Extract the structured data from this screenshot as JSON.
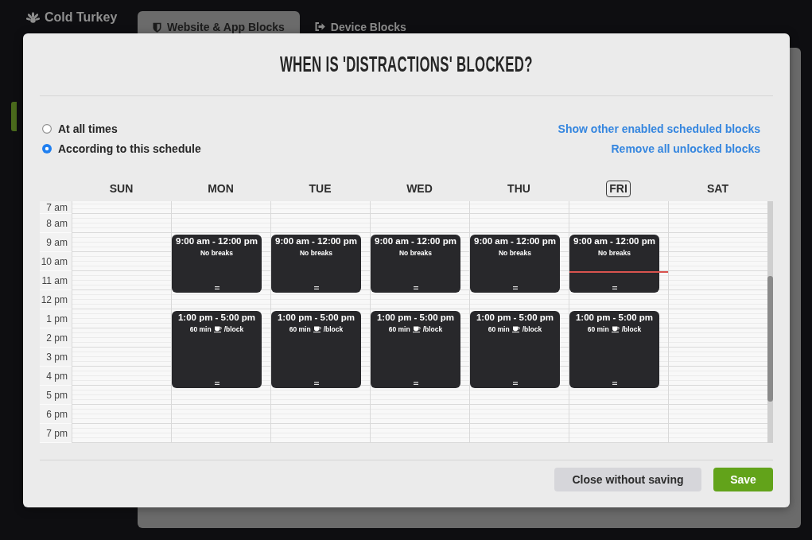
{
  "app": {
    "logo": {
      "name": "Cold Turkey"
    },
    "tabs": [
      {
        "label": "Website & App Blocks",
        "selected": true
      },
      {
        "label": "Device Blocks",
        "selected": false
      }
    ]
  },
  "dialog": {
    "title": "WHEN IS 'DISTRACTIONS' BLOCKED?",
    "mode_options": [
      {
        "label": "At all times",
        "selected": false
      },
      {
        "label": "According to this schedule",
        "selected": true
      }
    ],
    "links": [
      "Show other enabled scheduled blocks",
      "Remove all unlocked blocks"
    ],
    "calendar": {
      "hours": [
        "7 am",
        "8 am",
        "9 am",
        "10 am",
        "11 am",
        "12 pm",
        "1 pm",
        "2 pm",
        "3 pm",
        "4 pm",
        "5 pm",
        "6 pm",
        "7 pm"
      ],
      "days": [
        {
          "label": "SUN",
          "today": false
        },
        {
          "label": "MON",
          "today": false,
          "blocks": [
            {
              "time": "9:00 am - 12:00 pm",
              "kind": "no_breaks",
              "note": "No breaks"
            },
            {
              "time": "1:00 pm - 5:00 pm",
              "kind": "breaks",
              "break_length": "60 min",
              "break_unit": "/block"
            }
          ]
        },
        {
          "label": "TUE",
          "today": false,
          "blocks": [
            {
              "time": "9:00 am - 12:00 pm",
              "kind": "no_breaks",
              "note": "No breaks"
            },
            {
              "time": "1:00 pm - 5:00 pm",
              "kind": "breaks",
              "break_length": "60 min",
              "break_unit": "/block"
            }
          ]
        },
        {
          "label": "WED",
          "today": false,
          "blocks": [
            {
              "time": "9:00 am - 12:00 pm",
              "kind": "no_breaks",
              "note": "No breaks"
            },
            {
              "time": "1:00 pm - 5:00 pm",
              "kind": "breaks",
              "break_length": "60 min",
              "break_unit": "/block"
            }
          ]
        },
        {
          "label": "THU",
          "today": false,
          "blocks": [
            {
              "time": "9:00 am - 12:00 pm",
              "kind": "no_breaks",
              "note": "No breaks"
            },
            {
              "time": "1:00 pm - 5:00 pm",
              "kind": "breaks",
              "break_length": "60 min",
              "break_unit": "/block"
            }
          ]
        },
        {
          "label": "FRI",
          "today": true,
          "blocks": [
            {
              "time": "9:00 am - 12:00 pm",
              "kind": "no_breaks",
              "note": "No breaks"
            },
            {
              "time": "1:00 pm - 5:00 pm",
              "kind": "breaks",
              "break_length": "60 min",
              "break_unit": "/block"
            }
          ]
        },
        {
          "label": "SAT",
          "today": false
        }
      ]
    },
    "buttons": [
      {
        "label": "Close without saving",
        "kind": "secondary"
      },
      {
        "label": "Save",
        "kind": "primary"
      }
    ]
  }
}
